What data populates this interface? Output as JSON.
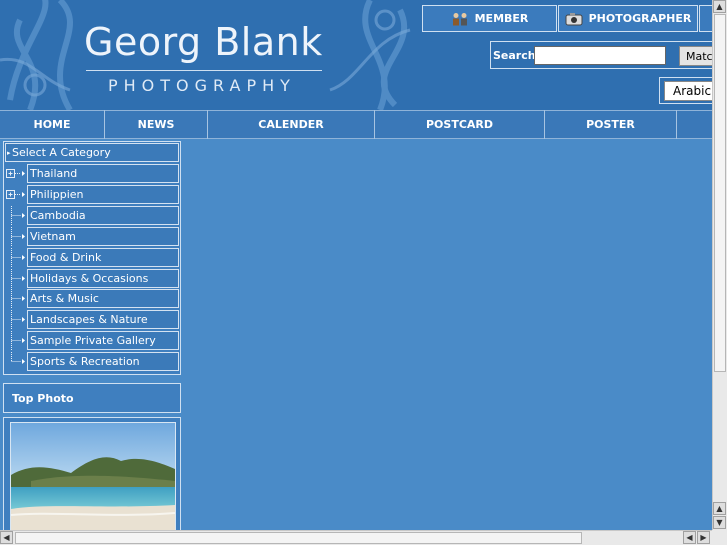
{
  "logo": {
    "name": "Georg Blank",
    "sub": "PHOTOGRAPHY"
  },
  "top_buttons": {
    "member": "MEMBER",
    "photographer": "PHOTOGRAPHER"
  },
  "search": {
    "label": "Search:",
    "value": "",
    "button": "Match"
  },
  "language": {
    "selected": "Arabic"
  },
  "nav": [
    "HOME",
    "NEWS",
    "CALENDER",
    "POSTCARD",
    "POSTER"
  ],
  "categories": {
    "header": "Select A Category",
    "items": [
      {
        "label": "Thailand",
        "expandable": true
      },
      {
        "label": "Philippien",
        "expandable": true
      },
      {
        "label": "Cambodia",
        "expandable": false
      },
      {
        "label": "Vietnam",
        "expandable": false
      },
      {
        "label": "Food & Drink",
        "expandable": false
      },
      {
        "label": "Holidays & Occasions",
        "expandable": false
      },
      {
        "label": "Arts & Music",
        "expandable": false
      },
      {
        "label": "Landscapes & Nature",
        "expandable": false
      },
      {
        "label": "Sample Private Gallery",
        "expandable": false
      },
      {
        "label": "Sports & Recreation",
        "expandable": false
      }
    ]
  },
  "top_photo": {
    "title": "Top Photo"
  },
  "colors": {
    "page_bg": "#4a8bc8",
    "header_bg": "#2f6fb0",
    "panel_border": "#cfe0f1"
  },
  "icons": {
    "member": "people-icon",
    "photographer": "camera-icon",
    "expand": "plus-box-icon",
    "arrow": "arrow-right-icon"
  }
}
